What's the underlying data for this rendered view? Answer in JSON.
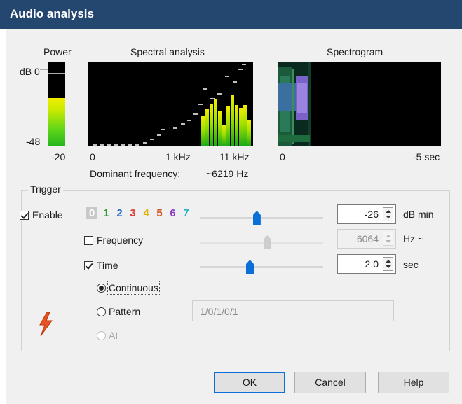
{
  "window": {
    "title": "Audio analysis"
  },
  "power": {
    "heading": "Power",
    "db_top": "dB 0",
    "db_bottom": "-48",
    "value": "-20",
    "level_fraction": 0.57,
    "peak_fraction": 0.87
  },
  "spectral": {
    "heading": "Spectral analysis",
    "axis": [
      "0",
      "1 kHz",
      "11 kHz"
    ],
    "dominant_label": "Dominant frequency:",
    "dominant_value": "~6219 Hz"
  },
  "spectrogram": {
    "heading": "Spectrogram",
    "axis_left": "0",
    "axis_right": "-5 sec"
  },
  "trigger": {
    "title": "Trigger",
    "enable": {
      "label": "Enable",
      "checked": true
    },
    "channels": [
      "0",
      "1",
      "2",
      "3",
      "4",
      "5",
      "6",
      "7"
    ],
    "channel_colors": [
      "#ffffff",
      "#2e9a36",
      "#2b6fd0",
      "#d63a2e",
      "#e0b100",
      "#d2521e",
      "#8a3fc4",
      "#22b5c9"
    ],
    "level": {
      "value": "-26",
      "unit": "dB min",
      "slider_fraction": 0.46
    },
    "frequency": {
      "label": "Frequency",
      "checked": false,
      "value": "6064",
      "unit": "Hz ~",
      "slider_fraction": 0.55
    },
    "time": {
      "label": "Time",
      "checked": true,
      "value": "2.0",
      "unit": "sec",
      "slider_fraction": 0.4
    },
    "modes": [
      {
        "label": "Continuous",
        "selected": true,
        "disabled": false
      },
      {
        "label": "Pattern",
        "selected": false,
        "disabled": false
      },
      {
        "label": "AI",
        "selected": false,
        "disabled": true
      }
    ],
    "pattern_value": "1/0/1/0/1",
    "icon": "lightning-bolt-icon"
  },
  "buttons": {
    "ok": "OK",
    "cancel": "Cancel",
    "help": "Help"
  },
  "colors": {
    "titlebar": "#23476f",
    "accent": "#0a6fd6",
    "bolt": "#e8531f"
  }
}
